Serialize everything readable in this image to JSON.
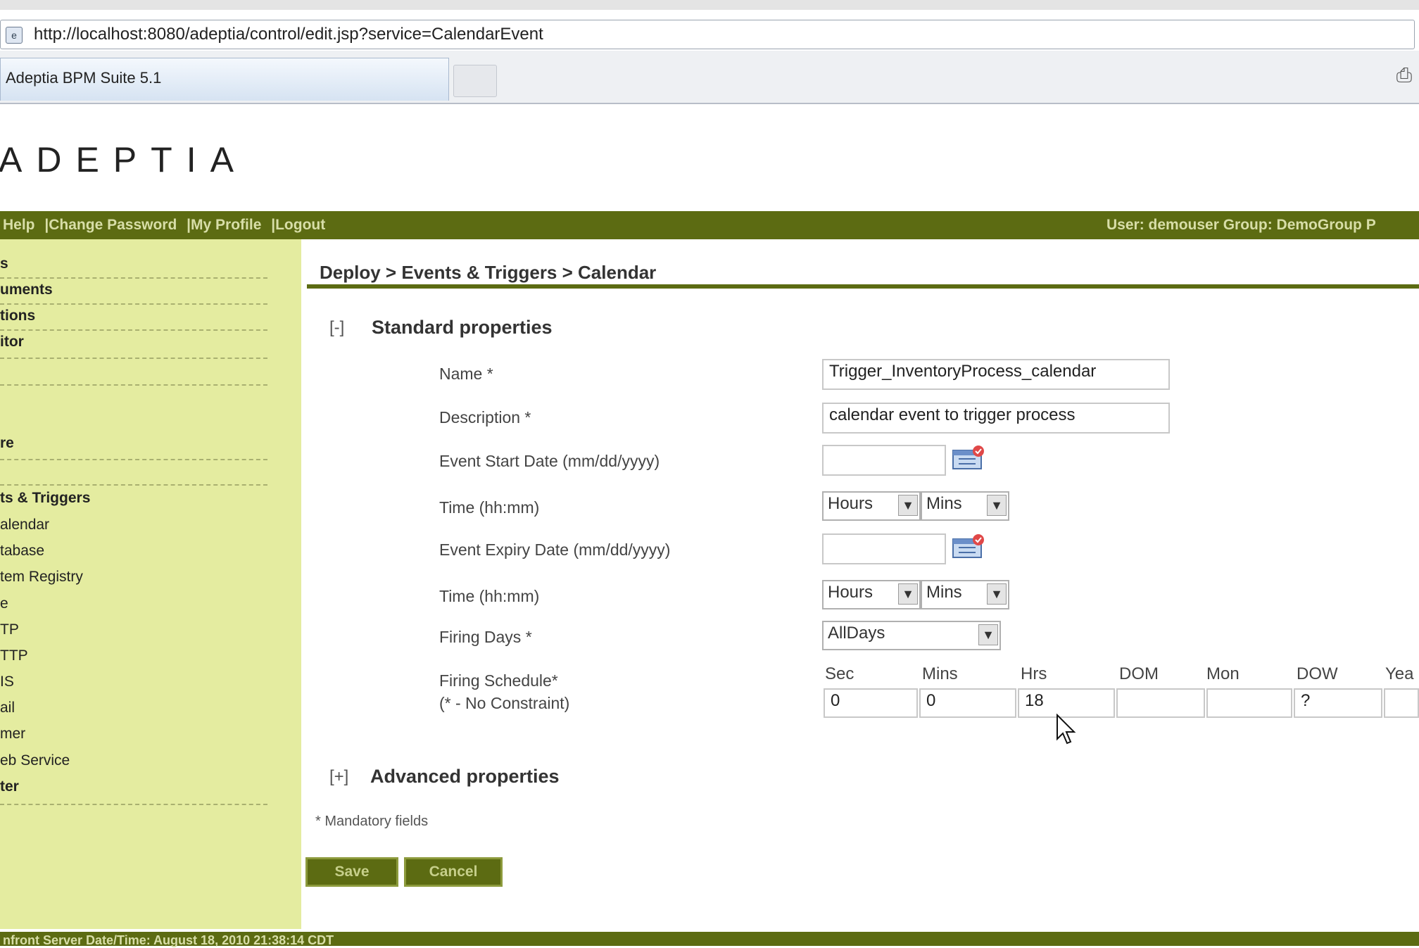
{
  "browser": {
    "url": "http://localhost:8080/adeptia/control/edit.jsp?service=CalendarEvent",
    "tab_title": "Adeptia BPM Suite 5.1"
  },
  "header": {
    "logo": "ADEPTIA",
    "nav_links": [
      "Help",
      "|Change Password",
      "|My Profile",
      "|Logout"
    ],
    "user_info": "User: demouser Group: DemoGroup P"
  },
  "sidebar": {
    "items": [
      {
        "label": "s",
        "bold": true
      },
      {
        "label": "uments",
        "bold": true
      },
      {
        "label": "tions",
        "bold": true
      },
      {
        "label": "itor",
        "bold": true
      },
      {
        "label": "re",
        "bold": true
      },
      {
        "label": "ts & Triggers",
        "bold": true
      },
      {
        "label": "alendar",
        "bold": false
      },
      {
        "label": "tabase",
        "bold": false
      },
      {
        "label": "tem Registry",
        "bold": false
      },
      {
        "label": "e",
        "bold": false
      },
      {
        "label": "TP",
        "bold": false
      },
      {
        "label": "TTP",
        "bold": false
      },
      {
        "label": "IS",
        "bold": false
      },
      {
        "label": "ail",
        "bold": false
      },
      {
        "label": "mer",
        "bold": false
      },
      {
        "label": "eb Service",
        "bold": false
      },
      {
        "label": "ter",
        "bold": true
      }
    ]
  },
  "main": {
    "breadcrumb": "Deploy > Events & Triggers > Calendar",
    "standard": {
      "toggle": "[-]",
      "title": "Standard properties"
    },
    "fields": {
      "name_label": "Name *",
      "name_value": "Trigger_InventoryProcess_calendar",
      "description_label": "Description *",
      "description_value": "calendar event to trigger process",
      "start_date_label": "Event Start Date  (mm/dd/yyyy)",
      "start_date_value": "",
      "time_label": "Time  (hh:mm)",
      "hours_select": "Hours",
      "mins_select": "Mins",
      "expiry_date_label": "Event Expiry Date  (mm/dd/yyyy)",
      "expiry_date_value": "",
      "firing_days_label": "Firing Days *",
      "firing_days_value": "AllDays",
      "firing_schedule_label": "Firing Schedule*",
      "firing_schedule_note": "(* - No Constraint)"
    },
    "schedule": {
      "headers": [
        "Sec",
        "Mins",
        "Hrs",
        "DOM",
        "Mon",
        "DOW",
        "Yea"
      ],
      "values": [
        "0",
        "0",
        "18",
        "",
        "",
        "?",
        ""
      ]
    },
    "advanced": {
      "toggle": "[+]",
      "title": "Advanced properties"
    },
    "mandatory_note": "* Mandatory fields",
    "save_label": "Save",
    "cancel_label": "Cancel"
  },
  "status_bar": "nfront  Server Date/Time:  August 18, 2010 21:38:14 CDT"
}
